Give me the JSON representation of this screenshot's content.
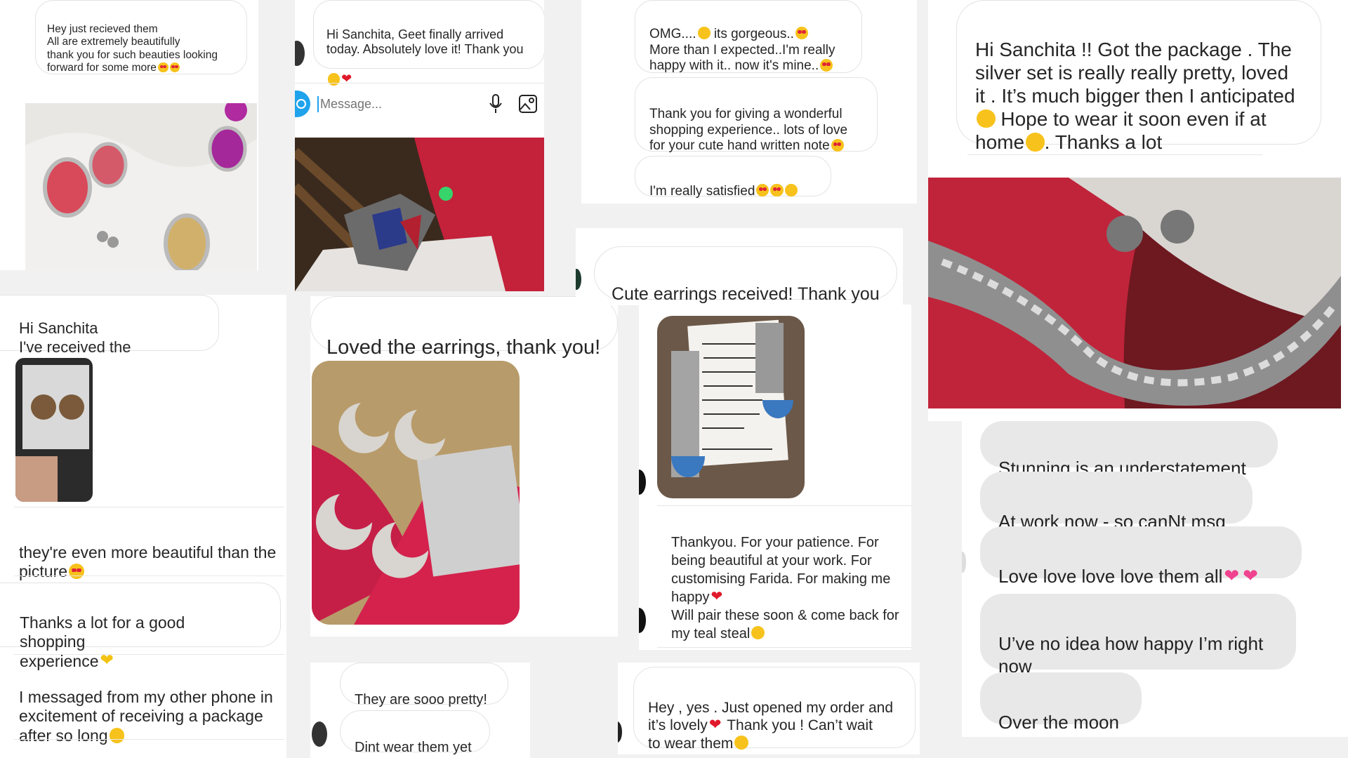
{
  "messages": {
    "m1": "Hey just recieved them\nAll are extremely beautifully\nthank you for such beauties looking\nforward for some more",
    "m2": "Hi Sanchita, Geet finally arrived\ntoday. Absolutely love it! Thank you",
    "m3a": "OMG....",
    "m3b": " its gorgeous..",
    "m3c": "More than I expected..I'm really\nhappy with it.. now it's mine..",
    "m4": "Thank you for giving a wonderful\nshopping experience.. lots of love\nfor your cute hand written note",
    "m5": "I'm really satisfied",
    "m6": "Hi Sanchita !! Got the package . The\nsilver set is really really pretty, loved\nit . It’s much bigger then I anticipated",
    "m6b": " Hope to wear it soon even if at\nhome",
    "m6c": ". Thanks a lot",
    "m7": "Cute earrings received! Thank you",
    "m8": "Hi Sanchita\nI've received the earrings.",
    "m9": "Loved the earrings, thank you!",
    "m10": "Thankyou. For your patience. For\nbeing  beautiful at your work. For\ncustomising Farida. For making me\nhappy",
    "m10b": "Will pair these soon & come back for\nmy teal steal",
    "m11": "they're even more beautiful than the\npicture",
    "m12": "Thanks a lot for a good shopping\nexperience",
    "m13": "I messaged from my other phone in\nexcitement of receiving a package\nafter so long",
    "m14": "They are sooo pretty!",
    "m15": "Dint wear them yet",
    "m16": "Hey , yes . Just opened my order and\nit’s lovely",
    "m16b": " Thank you ! Can’t wait\nto wear them",
    "g1": "Stunning is an understatement",
    "g2": "At work now - so canNt msg",
    "g3": "Love love love love them all",
    "g4": "U’ve no idea how happy I’m right\nnow",
    "g5": "Over the moon"
  },
  "composer": {
    "placeholder": "Message..."
  },
  "icons": [
    "mic-icon",
    "gallery-icon",
    "camera-icon"
  ],
  "colors": {
    "bubble_border": "#e3e3e3",
    "gray_bubble": "#e8e8e8",
    "heart": "#e0192a",
    "emoji": "#f7c21b"
  }
}
